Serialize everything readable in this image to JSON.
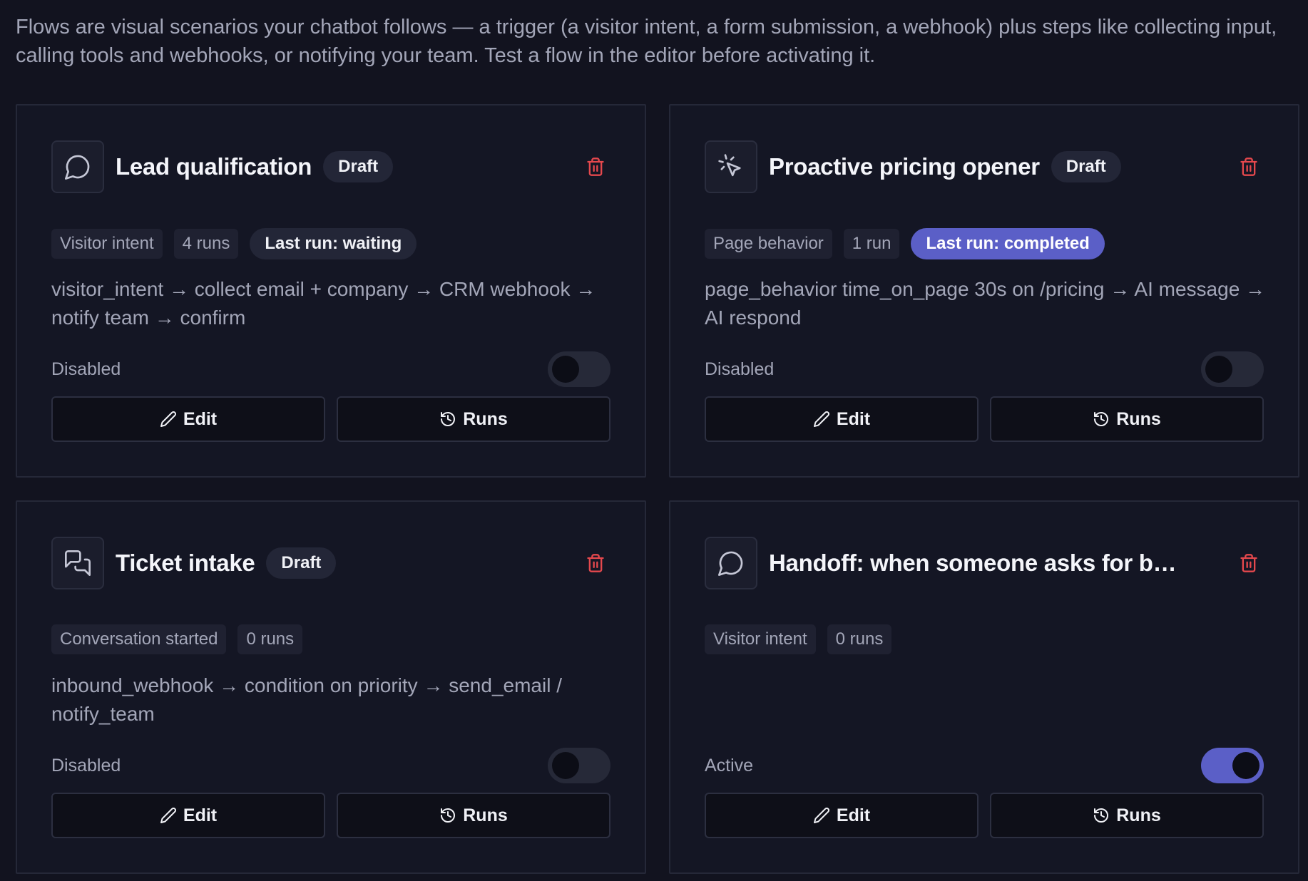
{
  "intro": "Flows are visual scenarios your chatbot follows — a trigger (a visitor intent, a form submission, a webhook) plus steps like collecting input, calling tools and webhooks, or notifying your team. Test a flow in the editor before activating it.",
  "flows": [
    {
      "title": "Lead qualification",
      "icon": "chat-bubble-icon",
      "badge": "Draft",
      "trigger": "Visitor intent",
      "runs": "4 runs",
      "last_run": "Last run: waiting",
      "description": "visitor_intent → collect email + company → CRM webhook → notify team → confirm",
      "status": "Disabled",
      "enabled": false,
      "edit_label": "Edit",
      "runs_label": "Runs"
    },
    {
      "title": "Proactive pricing opener",
      "icon": "cursor-click-icon",
      "badge": "Draft",
      "trigger": "Page behavior",
      "runs": "1 run",
      "last_run": "Last run: completed",
      "description": "page_behavior time_on_page 30s on /pricing → AI message → AI respond",
      "status": "Disabled",
      "enabled": false,
      "edit_label": "Edit",
      "runs_label": "Runs"
    },
    {
      "title": "Ticket intake",
      "icon": "chat-bubbles-icon",
      "badge": "Draft",
      "trigger": "Conversation started",
      "runs": "0 runs",
      "description": "inbound_webhook → condition on priority → send_email / notify_team",
      "status": "Disabled",
      "enabled": false,
      "edit_label": "Edit",
      "runs_label": "Runs"
    },
    {
      "title": "Handoff: when someone asks for buying...",
      "icon": "chat-bubble-icon",
      "trigger": "Visitor intent",
      "runs": "0 runs",
      "description": "",
      "status": "Active",
      "enabled": true,
      "edit_label": "Edit",
      "runs_label": "Runs"
    }
  ],
  "colors": {
    "accent": "#5b5fc7",
    "danger": "#e5484d",
    "background": "#12131f",
    "card": "#141624"
  }
}
